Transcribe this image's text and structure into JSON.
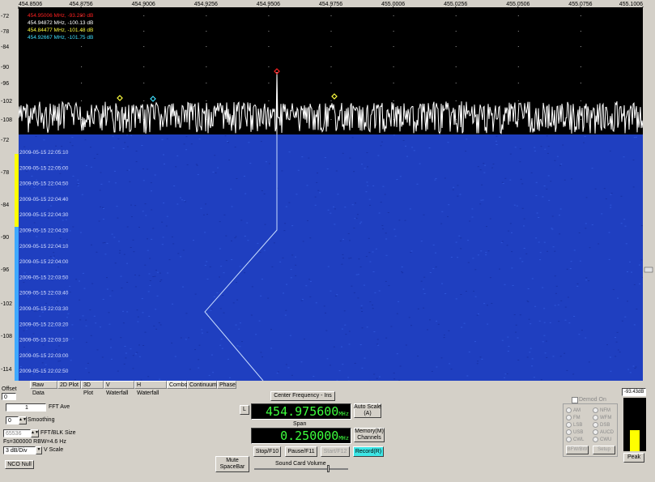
{
  "spectrum": {
    "freq_ticks": [
      "454.8506",
      "454.8756",
      "454.9006",
      "454.9256",
      "454.9506",
      "454.9756",
      "455.0006",
      "455.0256",
      "455.0506",
      "455.0756",
      "455.1006"
    ],
    "y_ticks": [
      "-72",
      "-78",
      "-84",
      "-90",
      "-96",
      "-102",
      "-108"
    ],
    "markers": [
      {
        "label": "454.95006 MHz, -93.280 dB",
        "color": "#ff2020"
      },
      {
        "label": "454.94872 MHz, -100.13 dB",
        "color": "#ffffff"
      },
      {
        "label": "454.84477 MHz, -101.48 dB",
        "color": "#ffff40"
      },
      {
        "label": "454.92667 MHz, -101.75 dB",
        "color": "#40e0ff"
      }
    ],
    "trace_color": "#ffffff",
    "background": "#000000"
  },
  "waterfall": {
    "y_ticks": [
      "-72",
      "-78",
      "-84",
      "-90",
      "-96",
      "-102",
      "-108",
      "-114"
    ],
    "timestamps": [
      "2009-05-15 22:05:10",
      "2009-05-15 22:05:00",
      "2009-05-15 22:04:50",
      "2009-05-15 22:04:40",
      "2009-05-15 22:04:30",
      "2009-05-15 22:04:20",
      "2009-05-15 22:04:10",
      "2009-05-15 22:04:00",
      "2009-05-15 22:03:50",
      "2009-05-15 22:03:40",
      "2009-05-15 22:03:30",
      "2009-05-15 22:03:20",
      "2009-05-15 22:03:10",
      "2009-05-15 22:03:00",
      "2009-05-15 22:02:50"
    ],
    "background": "#1f3fc0",
    "trace_color": "#c8dcff"
  },
  "tabs": [
    "Raw Data",
    "2D Plot",
    "3D Plot",
    "V Waterfall",
    "H Waterfall",
    "Combo",
    "Continuum",
    "Phase"
  ],
  "active_tab": "Combo",
  "controls": {
    "offset_label": "Offset",
    "offset_value": "0",
    "fft_ave_value": "1",
    "fft_ave_label": "FFT Ave",
    "smoothing_value": "0",
    "smoothing_label": "Smoothing",
    "fft_blk_value": "65536",
    "fft_blk_label": "FFT/BLK Size",
    "fs_info": "Fs=300000 RBW=4.6 Hz",
    "vscale_value": "3 dB/Div",
    "vscale_label": "V Scale",
    "nco_null": "NCO Null",
    "mute": "Mute\nSpaceBar",
    "center_freq_label": "Center Frequency - Ins",
    "l_button": "L",
    "center_freq": "454.975600",
    "mhz": "MHz",
    "auto_scale": "Auto Scale\n(A)",
    "span_label": "Span",
    "span": "0.250000",
    "memory": "Memory(M)\nChannels",
    "stop": "Stop/F10",
    "pause": "Pause/F11",
    "start": "Start/F12",
    "record": "Record(R)",
    "sound_card": "Sound Card Volume",
    "demod_on": "Demod On",
    "demod_modes_left": [
      "AM",
      "FM",
      "LSB",
      "USB",
      "CWL"
    ],
    "demod_modes_right": [
      "NFM",
      "WFM",
      "DSB",
      "AUCD",
      "CWU"
    ],
    "demod_btn1": "BFW/BW",
    "demod_btn2": "Setup",
    "level_value": "-93.43dB",
    "peak": "Peak",
    "accent_record": "#3ee6e6"
  }
}
